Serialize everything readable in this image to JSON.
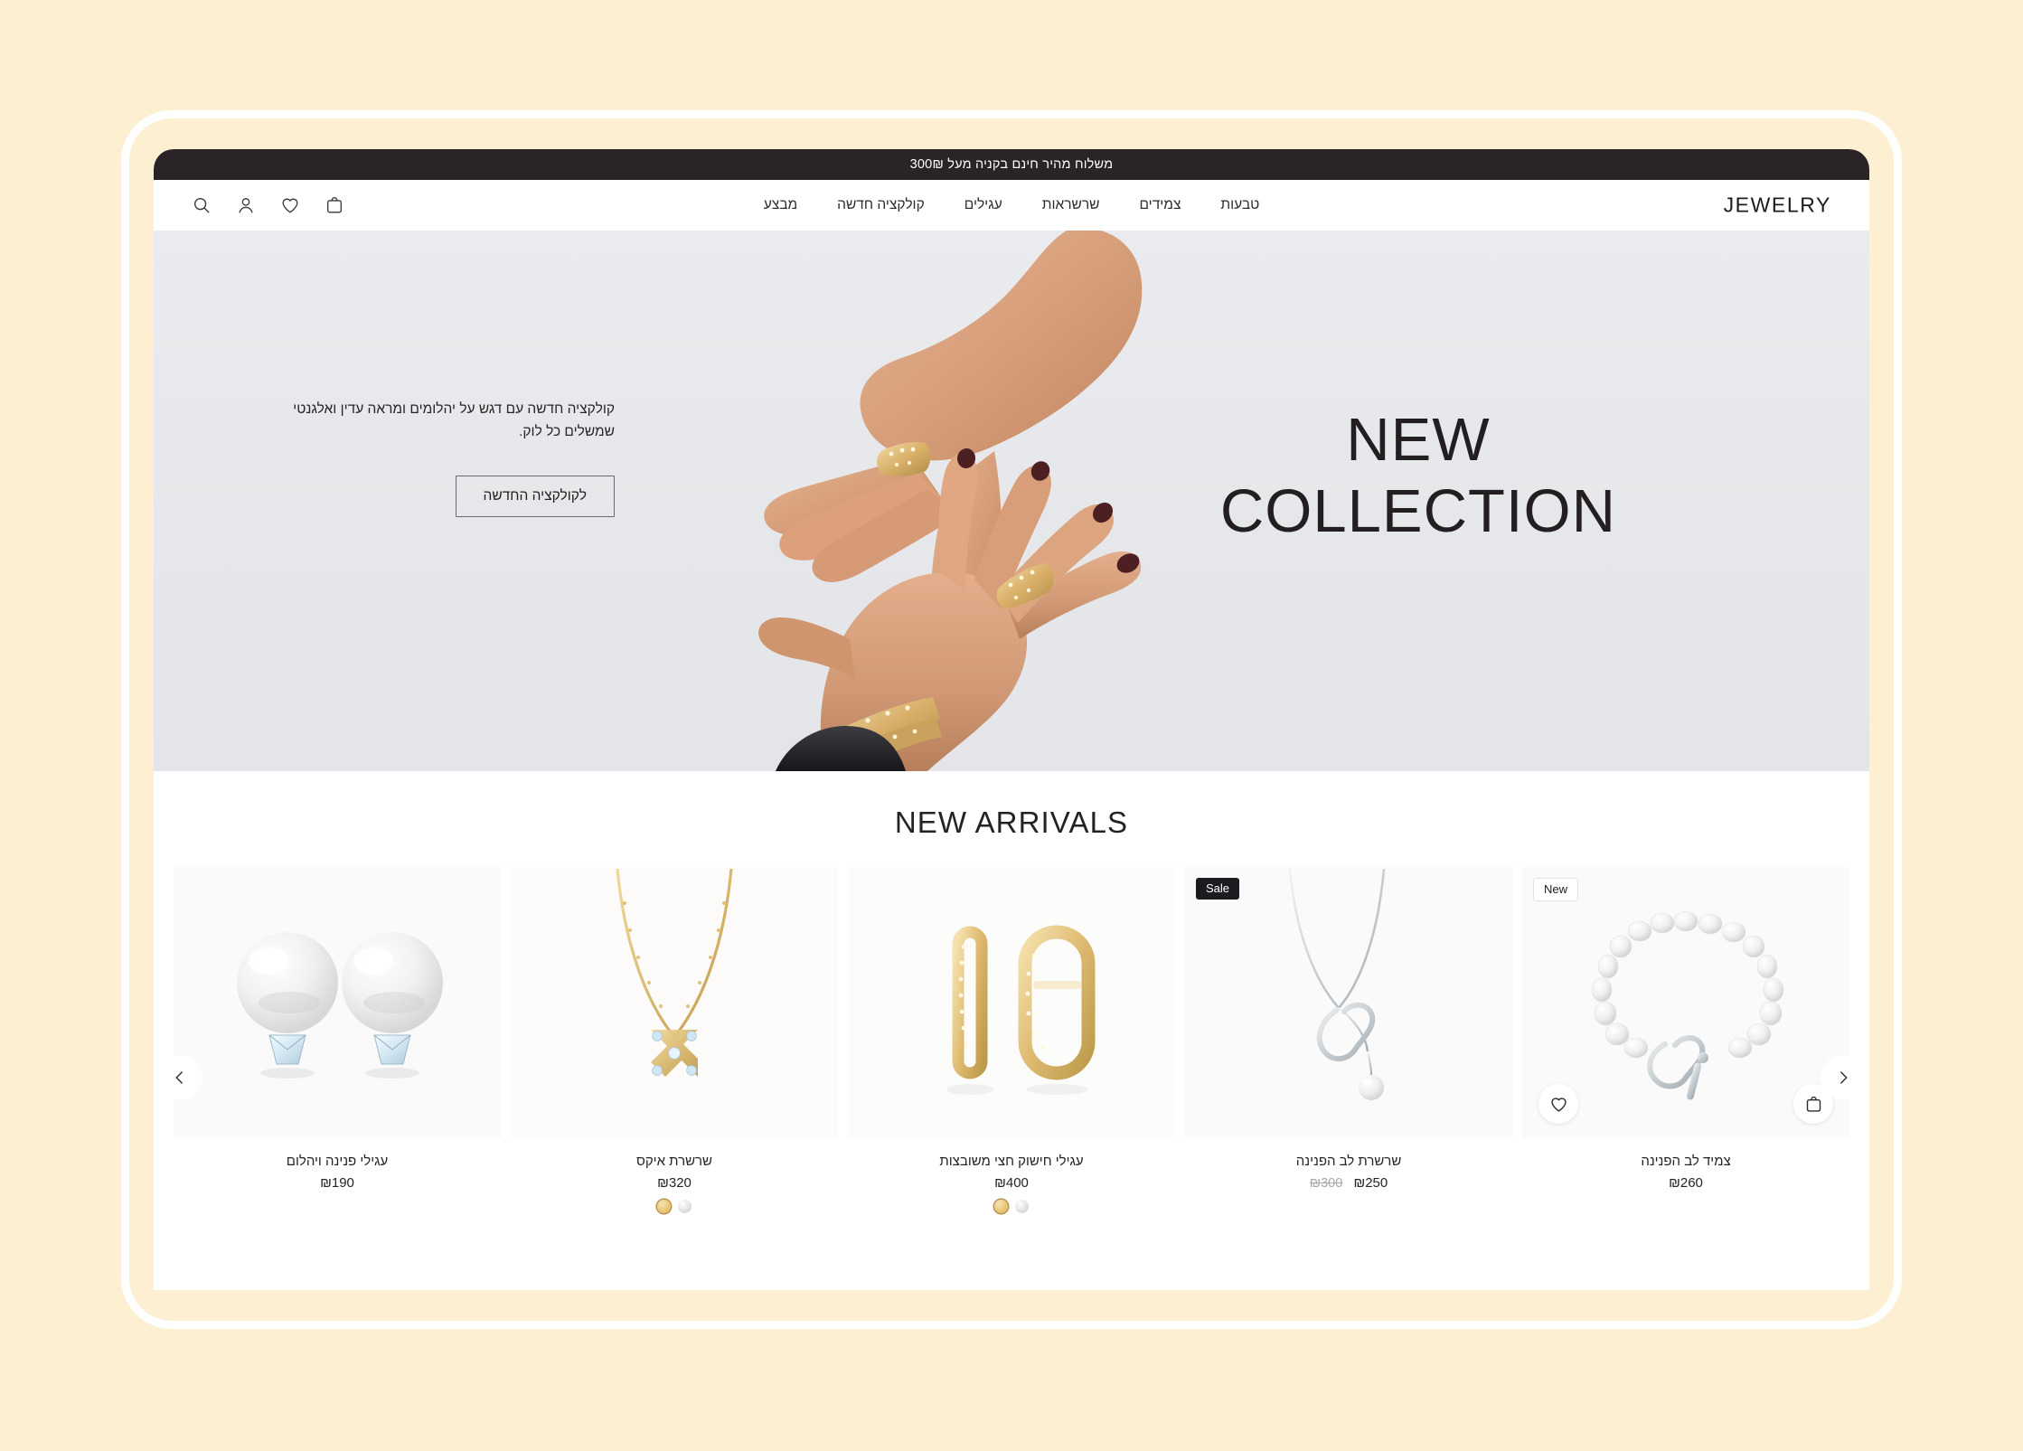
{
  "theme": {
    "page_background": "#FDF0D2",
    "frame_border": "#FFFFFF",
    "announce_background": "#2A2328",
    "hero_background": "#E6E8EB",
    "text_dark": "#232323",
    "badge_sale_bg": "#1E1B20",
    "swatch_gold": "#E8C878",
    "swatch_silver": "#E2E2E2"
  },
  "announcement": {
    "text": "משלוח מהיר חינם בקניה מעל 300₪"
  },
  "header": {
    "brand": "JEWELRY",
    "nav": [
      {
        "label": "טבעות"
      },
      {
        "label": "צמידים"
      },
      {
        "label": "שרשראות"
      },
      {
        "label": "עגילים"
      },
      {
        "label": "קולקציה חדשה"
      },
      {
        "label": "מבצע"
      }
    ],
    "icons": [
      {
        "name": "search-icon",
        "label": "חיפוש"
      },
      {
        "name": "user-icon",
        "label": "חשבון"
      },
      {
        "name": "heart-icon",
        "label": "מועדפים"
      },
      {
        "name": "cart-icon",
        "label": "עגלה"
      }
    ]
  },
  "hero": {
    "title": "NEW\nCOLLECTION",
    "description": "קולקציה חדשה עם דגש על יהלומים ומראה עדין ואלגנטי שמשלים כל לוק.",
    "cta_label": "לקולקציה החדשה"
  },
  "arrivals": {
    "title": "NEW ARRIVALS",
    "prev_label": "הקודם",
    "next_label": "הבא",
    "wishlist_label": "הוסף למועדפים",
    "addcart_label": "הוסף לעגלה",
    "products": [
      {
        "name": "עגילי פנינה ויהלום",
        "price": "₪190",
        "old_price": "",
        "badge": "",
        "swatches": [],
        "image": "pearl-diamond-earrings"
      },
      {
        "name": "שרשרת איקס",
        "price": "₪320",
        "old_price": "",
        "badge": "",
        "swatches": [
          "silver",
          "gold"
        ],
        "image": "x-pendant-necklace"
      },
      {
        "name": "עגילי חישוק חצי משובצות",
        "price": "₪400",
        "old_price": "",
        "badge": "",
        "swatches": [
          "silver",
          "gold"
        ],
        "image": "half-pave-hoop-earrings"
      },
      {
        "name": "שרשרת לב הפנינה",
        "price": "₪250",
        "old_price": "₪300",
        "badge": "Sale",
        "swatches": [],
        "image": "pearl-heart-necklace"
      },
      {
        "name": "צמיד לב הפנינה",
        "price": "₪260",
        "old_price": "",
        "badge": "New",
        "swatches": [],
        "image": "pearl-heart-bracelet"
      }
    ]
  }
}
